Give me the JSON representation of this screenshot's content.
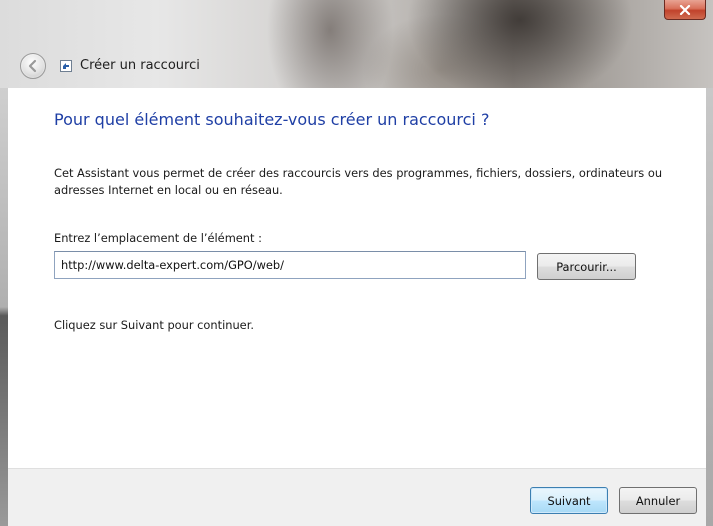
{
  "window": {
    "title": "Créer un raccourci",
    "close_icon": "close-icon",
    "back_icon": "back-arrow-icon",
    "app_icon": "shortcut-wizard-icon",
    "close_color": "#c1422b"
  },
  "main": {
    "heading": "Pour quel élément souhaitez-vous créer un raccourci ?",
    "description": "Cet Assistant vous permet de créer des raccourcis vers des programmes, fichiers, dossiers, ordinateurs ou adresses Internet en local ou en réseau.",
    "location_label": "Entrez l’emplacement de l’élément :",
    "location_value": "http://www.delta-expert.com/GPO/web/",
    "browse_label": "Parcourir...",
    "hint": "Cliquez sur Suivant pour continuer.",
    "heading_color": "#1f3fa5"
  },
  "footer": {
    "next_label": "Suivant",
    "cancel_label": "Annuler"
  }
}
